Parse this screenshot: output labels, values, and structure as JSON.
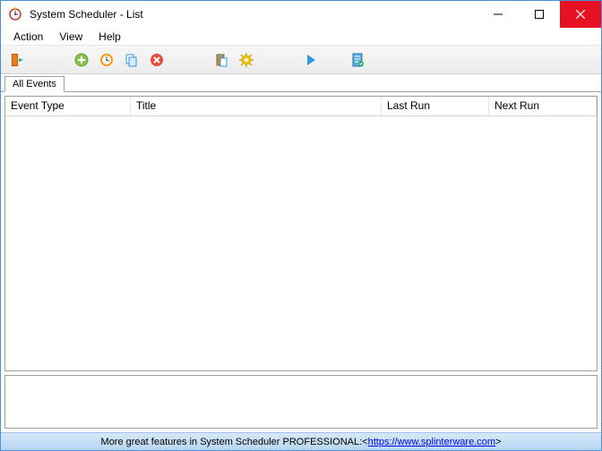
{
  "window": {
    "title": "System Scheduler - List"
  },
  "menu": {
    "action": "Action",
    "view": "View",
    "help": "Help"
  },
  "tabs": {
    "all_events": "All Events"
  },
  "columns": {
    "event_type": "Event Type",
    "title": "Title",
    "last_run": "Last Run",
    "next_run": "Next Run"
  },
  "status": {
    "text": "More great features in System Scheduler PROFESSIONAL: ",
    "link_open": "<",
    "link": "https://www.splinterware.com",
    "link_close": ">"
  }
}
